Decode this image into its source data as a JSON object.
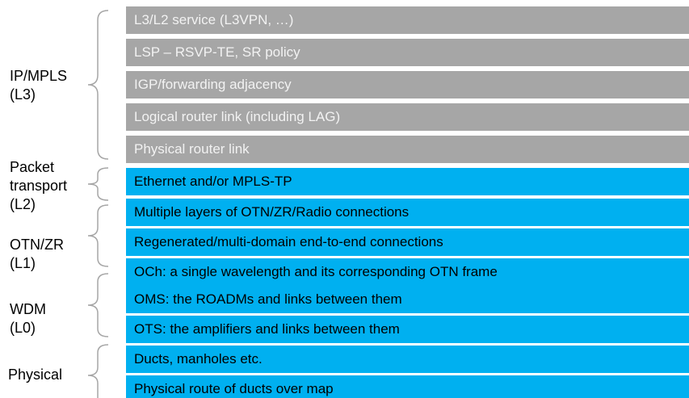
{
  "layers": [
    {
      "id": "l3",
      "label_lines": [
        "IP/MPLS",
        "(L3)"
      ]
    },
    {
      "id": "l2",
      "label_lines": [
        "Packet",
        "transport",
        "(L2)"
      ]
    },
    {
      "id": "l1",
      "label_lines": [
        "OTN/ZR",
        "(L1)"
      ]
    },
    {
      "id": "l0",
      "label_lines": [
        "WDM",
        "(L0)"
      ]
    },
    {
      "id": "phys",
      "label_lines": [
        "Physical"
      ]
    }
  ],
  "bars": [
    {
      "text": "L3/L2 service (L3VPN, …)",
      "color": "grey"
    },
    {
      "text": "LSP – RSVP-TE, SR policy",
      "color": "grey"
    },
    {
      "text": "IGP/forwarding adjacency",
      "color": "grey"
    },
    {
      "text": "Logical router link (including LAG)",
      "color": "grey"
    },
    {
      "text": "Physical router link",
      "color": "grey"
    },
    {
      "text": "Ethernet and/or MPLS-TP",
      "color": "blue"
    },
    {
      "text": "Multiple layers of OTN/ZR/Radio connections",
      "color": "blue"
    },
    {
      "text": "Regenerated/multi-domain end-to-end connections",
      "color": "blue"
    },
    {
      "text": "OCh: a single wavelength and its corresponding OTN frame",
      "color": "blue"
    },
    {
      "text": "OMS: the ROADMs and links between them",
      "color": "blue"
    },
    {
      "text": "OTS: the amplifiers and links between them",
      "color": "blue"
    },
    {
      "text": "Ducts, manholes etc.",
      "color": "blue"
    },
    {
      "text": "Physical route of ducts over map",
      "color": "blue"
    }
  ],
  "colors": {
    "grey_bar": "#a6a6a6",
    "grey_text": "#f2f2f2",
    "blue_bar": "#00b0f0",
    "brace": "#a6a6a6"
  }
}
